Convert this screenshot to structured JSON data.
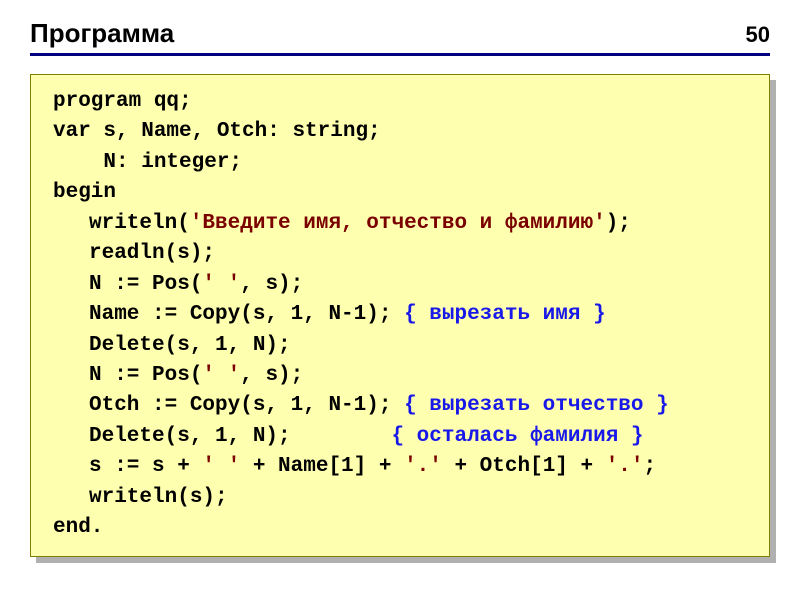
{
  "slide": {
    "title": "Программа",
    "page": "50"
  },
  "code": {
    "l1": "program qq;",
    "l2": "var s, Name, Otch: string;",
    "l3": "    N: integer;",
    "l4": "begin",
    "l5a": "writeln(",
    "l5b": "'Введите имя, отчество и фамилию'",
    "l5c": ");",
    "l6": "readln(s);",
    "l7a": "N := Pos(",
    "l7b": "' '",
    "l7c": ", s);",
    "l8a": "Name := Copy(s, 1, N-1); ",
    "l8b": "{ вырезать имя }",
    "l9": "Delete(s, 1, N);",
    "l10a": "N := Pos(",
    "l10b": "' '",
    "l10c": ", s);",
    "l11a": "Otch := Copy(s, 1, N-1); ",
    "l11b": "{ вырезать отчество }",
    "l12a": "Delete(s, 1, N);        ",
    "l12b": "{ осталась фамилия }",
    "l13a": "s := s + ",
    "l13b": "' '",
    "l13c": " + Name[1] + ",
    "l13d": "'.'",
    "l13e": " + Otch[1] + ",
    "l13f": "'.'",
    "l13g": ";",
    "l14": "writeln(s);",
    "l15": "end."
  }
}
